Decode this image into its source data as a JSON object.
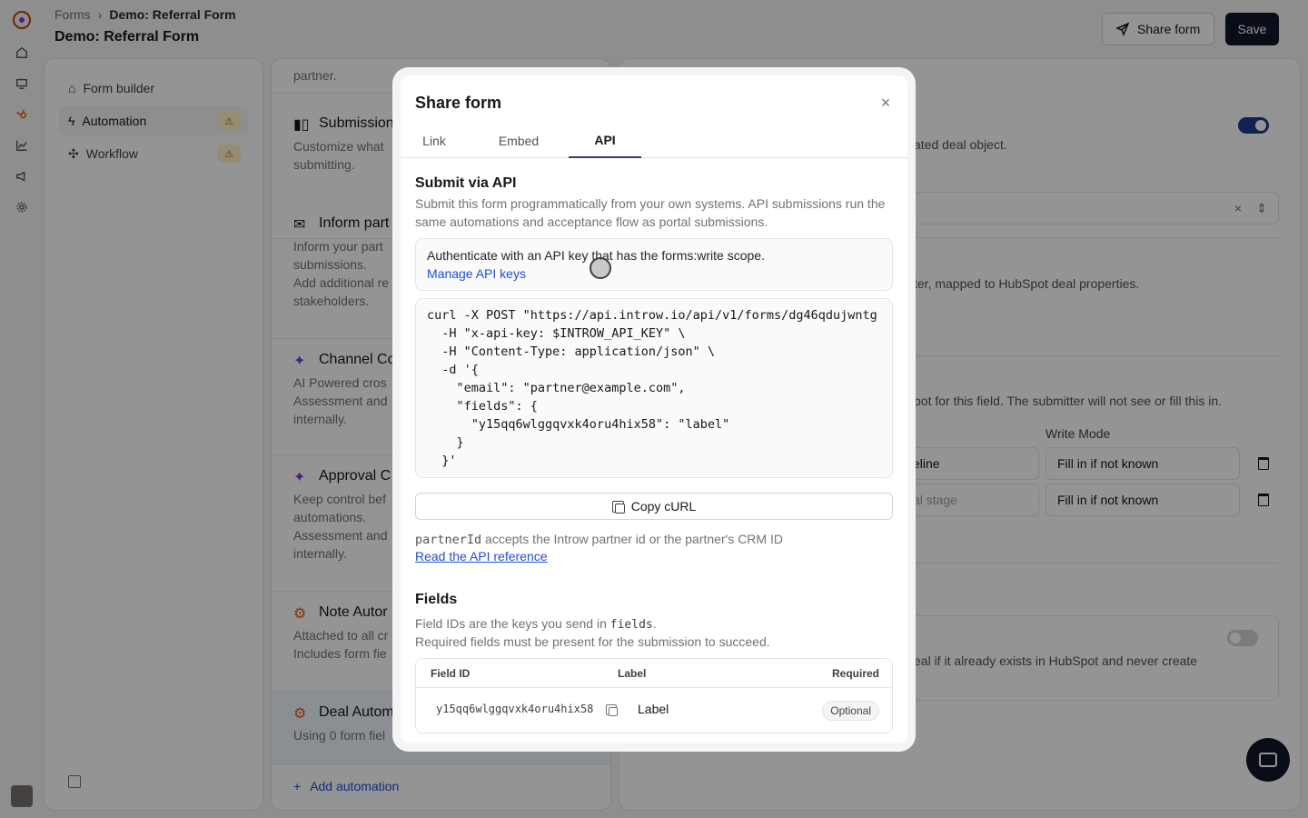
{
  "breadcrumb": {
    "root": "Forms",
    "separator": "›",
    "current": "Demo: Referral Form"
  },
  "page_title": "Demo: Referral Form",
  "header": {
    "share_label": "Share form",
    "save_label": "Save"
  },
  "sidebar": {
    "items": [
      {
        "label": "Form builder",
        "icon": "form-builder-icon"
      },
      {
        "label": "Automation",
        "icon": "bolt-icon",
        "warning": "⚠"
      },
      {
        "label": "Workflow",
        "icon": "workflow-icon",
        "warning": "⚠"
      }
    ]
  },
  "automations": {
    "cards": [
      {
        "title": "",
        "desc": "partner."
      },
      {
        "title": "Submission",
        "desc": "Customize what\nsubmitting."
      },
      {
        "title": "Inform part",
        "desc": "Inform your part\nsubmissions.\nAdd additional re\nstakeholders."
      },
      {
        "title": "Channel Co",
        "desc": "AI Powered cros\nAssessment and\ninternally."
      },
      {
        "title": "Approval C",
        "desc": "Keep control bef\nautomations.\nAssessment and\ninternally."
      },
      {
        "title": "Note Autor",
        "desc": "Attached to all cr\nIncludes form fie"
      },
      {
        "title": "Deal Autom",
        "desc": "Using 0 form fiel"
      }
    ],
    "add_label": "Add automation"
  },
  "right_panel": {
    "text1": "ated deal object.",
    "text2": "ter, mapped to HubSpot deal properties.",
    "text3": "pot for this field. The submitter will not see or fill this in.",
    "write_mode_label": "Write Mode",
    "select1": "eline",
    "select2": "al stage",
    "mode1": "Fill in if not known",
    "mode2": "Fill in if not known",
    "text4": "eal if it already exists in HubSpot and never create"
  },
  "modal": {
    "title": "Share form",
    "close": "×",
    "tabs": [
      "Link",
      "Embed",
      "API"
    ],
    "active_tab": "API",
    "section_title": "Submit via API",
    "section_desc": "Submit this form programmatically from your own systems. API submissions run the same automations and acceptance flow as portal submissions.",
    "auth_text": "Authenticate with an API key that has the forms:write scope.",
    "auth_link": "Manage API keys",
    "code_lines": [
      "curl -X POST \"https://api.introw.io/api/v1/forms/dg46qdujwntg",
      "  -H \"x-api-key: $INTROW_API_KEY\" \\",
      "  -H \"Content-Type: application/json\" \\",
      "  -d '{",
      "    \"email\": \"partner@example.com\",",
      "    \"fields\": {",
      "      \"y15qq6wlggqvxk4oru4hix58\": \"label\"",
      "    }",
      "  }'"
    ],
    "copy_label": "Copy cURL",
    "partner_code": "partnerId",
    "partner_text": " accepts the Introw partner id or the partner's CRM ID",
    "api_ref": "Read the API reference",
    "fields_title": "Fields",
    "fields_desc_pre": "Field IDs are the keys you send in ",
    "fields_desc_code": "fields",
    "fields_desc_post": ".",
    "fields_desc2": "Required fields must be present for the submission to succeed.",
    "table": {
      "headers": [
        "Field ID",
        "Label",
        "Required"
      ],
      "rows": [
        {
          "id": "y15qq6wlggqvxk4oru4hix58",
          "label": "Label",
          "required": "Optional"
        }
      ]
    }
  }
}
